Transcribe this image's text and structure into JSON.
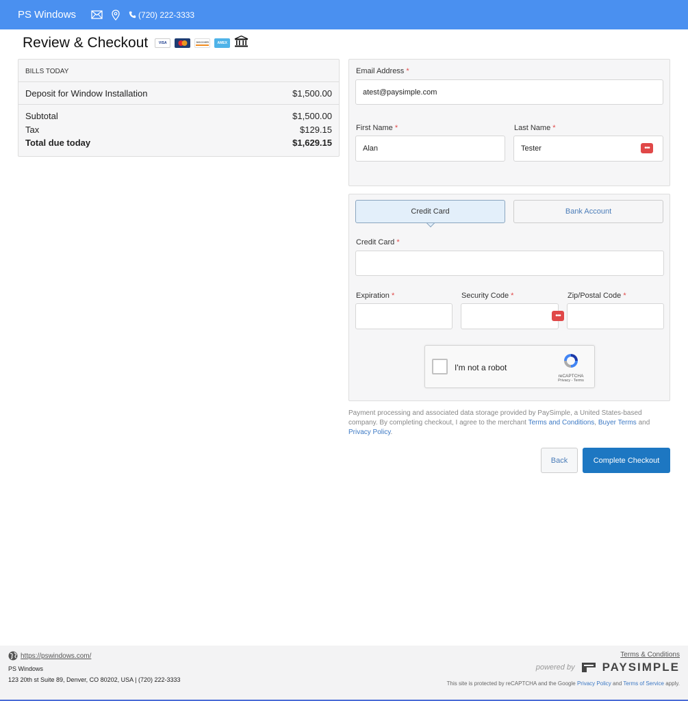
{
  "header": {
    "brand": "PS Windows",
    "phone": "(720) 222-3333"
  },
  "page": {
    "title": "Review & Checkout",
    "card_logos": [
      "VISA",
      "DISCOVER",
      "AMEX"
    ]
  },
  "bills": {
    "heading": "BILLS TODAY",
    "items": [
      {
        "description": "Deposit for Window Installation",
        "amount": "$1,500.00"
      }
    ],
    "subtotal_label": "Subtotal",
    "subtotal_value": "$1,500.00",
    "tax_label": "Tax",
    "tax_value": "$129.15",
    "total_label": "Total due today",
    "total_value": "$1,629.15"
  },
  "contact": {
    "email_label": "Email Address",
    "email_value": "atest@paysimple.com",
    "first_name_label": "First Name",
    "first_name_value": "Alan",
    "last_name_label": "Last Name",
    "last_name_value": "Tester",
    "required_mark": "*"
  },
  "payment": {
    "tabs": [
      {
        "label": "Credit Card",
        "active": true
      },
      {
        "label": "Bank Account",
        "active": false
      }
    ],
    "card_label": "Credit Card",
    "expiration_label": "Expiration",
    "security_label": "Security Code",
    "zip_label": "Zip/Postal Code"
  },
  "recaptcha": {
    "label": "I'm not a robot",
    "brand": "reCAPTCHA",
    "links": "Privacy - Terms"
  },
  "disclaimer": {
    "text": "Payment processing and associated data storage provided by PaySimple, a United States-based company. By completing checkout, I agree to the merchant",
    "terms_link": "Terms and Conditions",
    "buyer_link": "Buyer Terms",
    "and": "and",
    "privacy_link": "Privacy Policy"
  },
  "actions": {
    "back_label": "Back",
    "complete_label": "Complete Checkout"
  },
  "footer": {
    "url": "https://pswindows.com/",
    "name": "PS Windows",
    "address": "123 20th st Suite 89, Denver, CO 80202, USA | (720) 222-3333",
    "terms": "Terms & Conditions",
    "powered_by": "powered by",
    "paysimple": "PAYSIMPLE",
    "recaptcha_notice": "This site is protected by reCAPTCHA and the Google",
    "privacy_policy": "Privacy Policy",
    "and": "and",
    "terms_of_service": "Terms of Service",
    "apply": "apply."
  },
  "colors": {
    "header_bg": "#4a90f0",
    "primary_button": "#1d77c2",
    "required": "#e04848",
    "link": "#3b78c4"
  },
  "icons": [
    "envelope-icon",
    "map-pin-icon",
    "phone-icon",
    "bank-icon",
    "password-manager-icon",
    "globe-icon",
    "paysimple-logo-icon",
    "recaptcha-logo-icon"
  ]
}
